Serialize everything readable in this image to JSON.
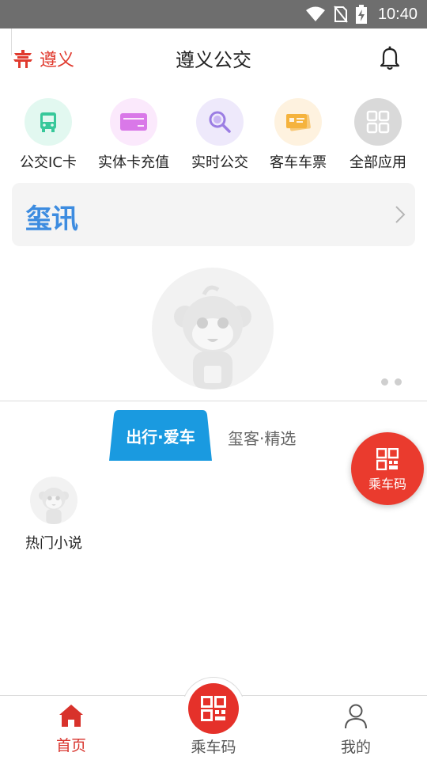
{
  "status_bar": {
    "time": "10:40",
    "icons": [
      "wifi-icon",
      "no-sim-icon",
      "battery-charging-icon"
    ]
  },
  "header": {
    "city": "遵义",
    "title": "遵义公交",
    "city_icon": "pagoda-icon",
    "bell_icon": "bell-icon"
  },
  "apps": [
    {
      "label": "公交IC卡",
      "icon": "bus-icon",
      "color": "#37c89a",
      "bg": "#e2f8f0"
    },
    {
      "label": "实体卡充值",
      "icon": "card-icon",
      "color": "#d978e8",
      "bg": "#fbe9fc"
    },
    {
      "label": "实时公交",
      "icon": "search-icon",
      "color": "#9b7de3",
      "bg": "#eee9fb"
    },
    {
      "label": "客车车票",
      "icon": "ticket-icon",
      "color": "#f5b33d",
      "bg": "#fef2df"
    },
    {
      "label": "全部应用",
      "icon": "grid-icon",
      "color": "#ffffff",
      "bg": "#d9d9d9"
    }
  ],
  "news": {
    "brand": "玺讯",
    "chevron": "chevron-right-icon"
  },
  "banner": {
    "image": "monkey-mascot-placeholder",
    "pages": 2
  },
  "tabs": [
    {
      "label": "出行·爱车",
      "active": true,
      "color": "#1a9ae0"
    },
    {
      "label": "玺客·精选",
      "active": false
    }
  ],
  "fab": {
    "label": "乘车码",
    "icon": "qr-code-icon",
    "color": "#ea3b2e"
  },
  "content_items": [
    {
      "label": "热门小说",
      "icon": "monkey-avatar-placeholder"
    }
  ],
  "bottom_nav": {
    "home": {
      "label": "首页",
      "icon": "home-icon",
      "color": "#d8322b"
    },
    "ride_code": {
      "label": "乘车码",
      "icon": "qr-code-icon"
    },
    "mine": {
      "label": "我的",
      "icon": "person-icon"
    }
  }
}
